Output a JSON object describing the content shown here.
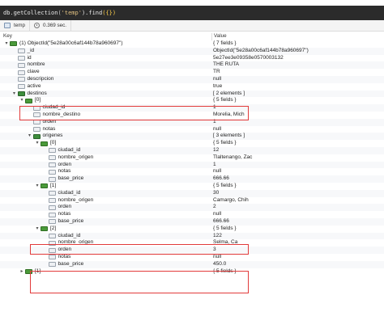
{
  "query": {
    "prefix": "db.getCollection",
    "open": "(",
    "collection": "'temp'",
    "mid": ").find",
    "args": "({})"
  },
  "status": {
    "collection": "temp",
    "time": "0.369 sec."
  },
  "header": {
    "key": "Key",
    "value": "Value"
  },
  "rows": [
    {
      "key": "(1) ObjectId(\"5e28a00c6af144b78a960697\")",
      "value": "{ 7 fields }",
      "depth": 0,
      "icon": "doc",
      "arrow": "expanded"
    },
    {
      "key": "_id",
      "value": "ObjectId(\"5e28a00c6af144b78a960697\")",
      "depth": 1,
      "icon": "field",
      "arrow": ""
    },
    {
      "key": "id",
      "value": "5e27ee3e09358e0570003132",
      "depth": 1,
      "icon": "field",
      "arrow": ""
    },
    {
      "key": "nombre",
      "value": "THE RUTA",
      "depth": 1,
      "icon": "field",
      "arrow": ""
    },
    {
      "key": "clave",
      "value": "TR",
      "depth": 1,
      "icon": "field",
      "arrow": ""
    },
    {
      "key": "descripcion",
      "value": "null",
      "depth": 1,
      "icon": "field",
      "arrow": ""
    },
    {
      "key": "active",
      "value": "true",
      "depth": 1,
      "icon": "field",
      "arrow": ""
    },
    {
      "key": "destinos",
      "value": "[ 2 elements ]",
      "depth": 1,
      "icon": "arr",
      "arrow": "expanded"
    },
    {
      "key": "[0]",
      "value": "{ 5 fields }",
      "depth": 2,
      "icon": "doc",
      "arrow": "expanded"
    },
    {
      "key": "ciudad_id",
      "value": "1",
      "depth": 3,
      "icon": "field",
      "arrow": ""
    },
    {
      "key": "nombre_destino",
      "value": "Morelia, Mich",
      "depth": 3,
      "icon": "field",
      "arrow": ""
    },
    {
      "key": "orden",
      "value": "1",
      "depth": 3,
      "icon": "field",
      "arrow": ""
    },
    {
      "key": "notas",
      "value": "null",
      "depth": 3,
      "icon": "field",
      "arrow": ""
    },
    {
      "key": "origenes",
      "value": "[ 3 elements ]",
      "depth": 3,
      "icon": "arr",
      "arrow": "expanded"
    },
    {
      "key": "[0]",
      "value": "{ 5 fields }",
      "depth": 4,
      "icon": "doc",
      "arrow": "expanded"
    },
    {
      "key": "ciudad_id",
      "value": "12",
      "depth": 5,
      "icon": "field",
      "arrow": ""
    },
    {
      "key": "nombre_origen",
      "value": "Tlaltenango, Zac",
      "depth": 5,
      "icon": "field",
      "arrow": ""
    },
    {
      "key": "orden",
      "value": "1",
      "depth": 5,
      "icon": "field",
      "arrow": ""
    },
    {
      "key": "notas",
      "value": "null",
      "depth": 5,
      "icon": "field",
      "arrow": ""
    },
    {
      "key": "base_price",
      "value": "666.66",
      "depth": 5,
      "icon": "field",
      "arrow": ""
    },
    {
      "key": "[1]",
      "value": "{ 5 fields }",
      "depth": 4,
      "icon": "doc",
      "arrow": "expanded"
    },
    {
      "key": "ciudad_id",
      "value": "30",
      "depth": 5,
      "icon": "field",
      "arrow": ""
    },
    {
      "key": "nombre_origen",
      "value": "Camargo, Chih",
      "depth": 5,
      "icon": "field",
      "arrow": ""
    },
    {
      "key": "orden",
      "value": "2",
      "depth": 5,
      "icon": "field",
      "arrow": ""
    },
    {
      "key": "notas",
      "value": "null",
      "depth": 5,
      "icon": "field",
      "arrow": ""
    },
    {
      "key": "base_price",
      "value": "666.66",
      "depth": 5,
      "icon": "field",
      "arrow": ""
    },
    {
      "key": "[2]",
      "value": "{ 5 fields }",
      "depth": 4,
      "icon": "doc",
      "arrow": "expanded"
    },
    {
      "key": "ciudad_id",
      "value": "122",
      "depth": 5,
      "icon": "field",
      "arrow": ""
    },
    {
      "key": "nombre_origen",
      "value": "Selma, Ca",
      "depth": 5,
      "icon": "field",
      "arrow": ""
    },
    {
      "key": "orden",
      "value": "3",
      "depth": 5,
      "icon": "field",
      "arrow": ""
    },
    {
      "key": "notas",
      "value": "null",
      "depth": 5,
      "icon": "field",
      "arrow": ""
    },
    {
      "key": "base_price",
      "value": "450.0",
      "depth": 5,
      "icon": "field",
      "arrow": ""
    },
    {
      "key": "[1]",
      "value": "{ 5 fields }",
      "depth": 2,
      "icon": "doc",
      "arrow": "collapsed"
    }
  ],
  "colors": {
    "query_bg": "#2b2b2b",
    "highlight": "#e23b3b",
    "doc_icon": "#4a9a3a"
  }
}
